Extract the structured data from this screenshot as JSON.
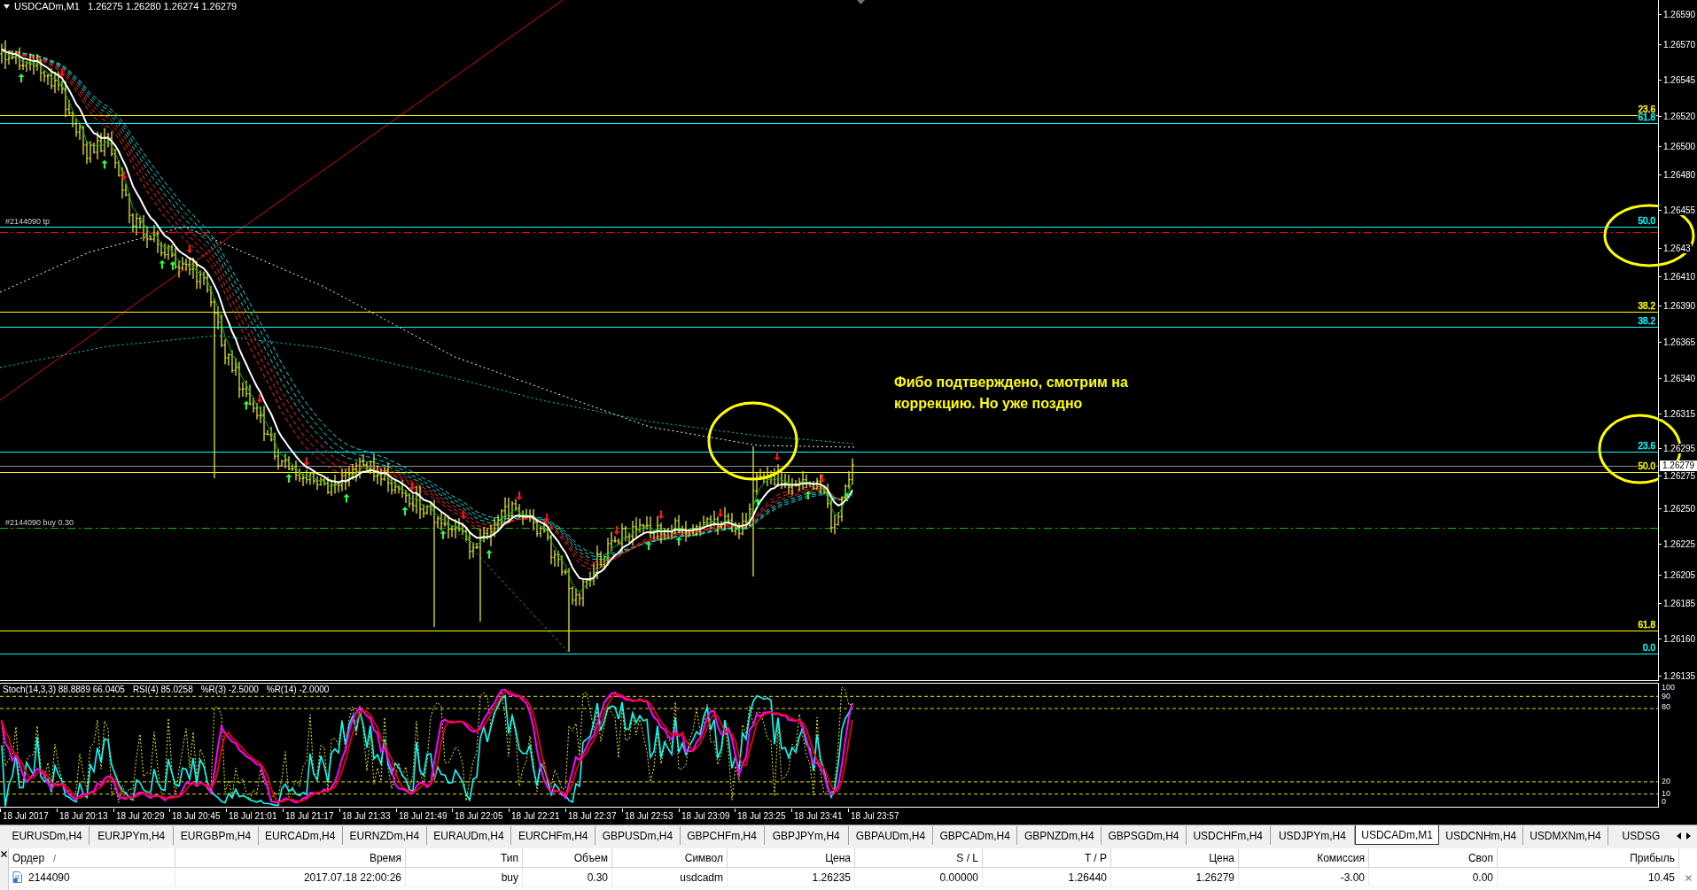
{
  "chart": {
    "symbol": "USDCADm,M1",
    "quote": "1.26275 1.26280 1.26274 1.26279",
    "price_axis": [
      "1.26590",
      "1.26570",
      "1.26545",
      "1.26520",
      "1.26500",
      "1.26480",
      "1.26455",
      "1.2643",
      "1.26410",
      "1.26390",
      "1.26365",
      "1.26340",
      "1.26315",
      "1.26295",
      "1.26275",
      "1.26250",
      "1.26225",
      "1.26205",
      "1.26185",
      "1.26160",
      "1.26135"
    ],
    "current_price": "1.26279",
    "fibo_levels": [
      {
        "label": "23.6",
        "color": "#ffff00"
      },
      {
        "label": "61.8",
        "color": "#00ffff"
      },
      {
        "label": "50.0",
        "color": "#00ffff"
      },
      {
        "label": "38.2",
        "color": "#ffff00"
      },
      {
        "label": "38.2",
        "color": "#00ffff"
      },
      {
        "label": "23.6",
        "color": "#00ffff"
      },
      {
        "label": "50.0",
        "color": "#ffff00"
      },
      {
        "label": "61.8",
        "color": "#ffff00"
      },
      {
        "label": "0.0",
        "color": "#00ffff"
      }
    ],
    "trade_lines": [
      {
        "label": "#2144090 tp",
        "kind": "take_profit"
      },
      {
        "label": "#2144090 buy 0.30",
        "kind": "entry"
      }
    ],
    "annotation": "Фибо подтверждено, смотрим на коррекцию. Но уже поздно"
  },
  "oscillator": {
    "legend": [
      "Stoch(14,3,3) 88.8889 66.0405",
      "RSI(4) 85.0258",
      "%R(3) -2.5000",
      "%R(14) -2.0000"
    ],
    "axis": [
      "100",
      "90",
      "80",
      "20",
      "10",
      "0"
    ]
  },
  "time_axis": [
    "18 Jul 2017",
    "18 Jul 20:13",
    "18 Jul 20:29",
    "18 Jul 20:45",
    "18 Jul 21:01",
    "18 Jul 21:17",
    "18 Jul 21:33",
    "18 Jul 21:49",
    "18 Jul 22:05",
    "18 Jul 22:21",
    "18 Jul 22:37",
    "18 Jul 22:53",
    "18 Jul 23:09",
    "18 Jul 23:25",
    "18 Jul 23:41",
    "18 Jul 23:57"
  ],
  "symbol_tabs": [
    {
      "label": "EURUSDm,H4",
      "selected": false
    },
    {
      "label": "EURJPYm,H4",
      "selected": false
    },
    {
      "label": "EURGBPm,H4",
      "selected": false
    },
    {
      "label": "EURCADm,H4",
      "selected": false
    },
    {
      "label": "EURNZDm,H4",
      "selected": false
    },
    {
      "label": "EURAUDm,H4",
      "selected": false
    },
    {
      "label": "EURCHFm,H4",
      "selected": false
    },
    {
      "label": "GBPUSDm,H4",
      "selected": false
    },
    {
      "label": "GBPCHFm,H4",
      "selected": false
    },
    {
      "label": "GBPJPYm,H4",
      "selected": false
    },
    {
      "label": "GBPAUDm,H4",
      "selected": false
    },
    {
      "label": "GBPCADm,H4",
      "selected": false
    },
    {
      "label": "GBPNZDm,H4",
      "selected": false
    },
    {
      "label": "GBPSGDm,H4",
      "selected": false
    },
    {
      "label": "USDCHFm,H4",
      "selected": false
    },
    {
      "label": "USDJPYm,H4",
      "selected": false
    },
    {
      "label": "USDCADm,M1",
      "selected": true
    },
    {
      "label": "USDCNHm,H4",
      "selected": false
    },
    {
      "label": "USDMXNm,H4",
      "selected": false
    },
    {
      "label": "USDSG",
      "selected": false
    }
  ],
  "terminal": {
    "columns": [
      "Ордер",
      "Время",
      "Тип",
      "Объем",
      "Символ",
      "Цена",
      "S / L",
      "T / P",
      "Цена",
      "Комиссия",
      "Своп",
      "Прибыль"
    ],
    "sort_indicator": "/",
    "rows": [
      {
        "cells": [
          "2144090",
          "2017.07.18 22:00:26",
          "buy",
          "0.30",
          "usdcadm",
          "1.26235",
          "0.00000",
          "1.26440",
          "1.26279",
          "-3.00",
          "0.00",
          "10.45"
        ]
      }
    ]
  }
}
